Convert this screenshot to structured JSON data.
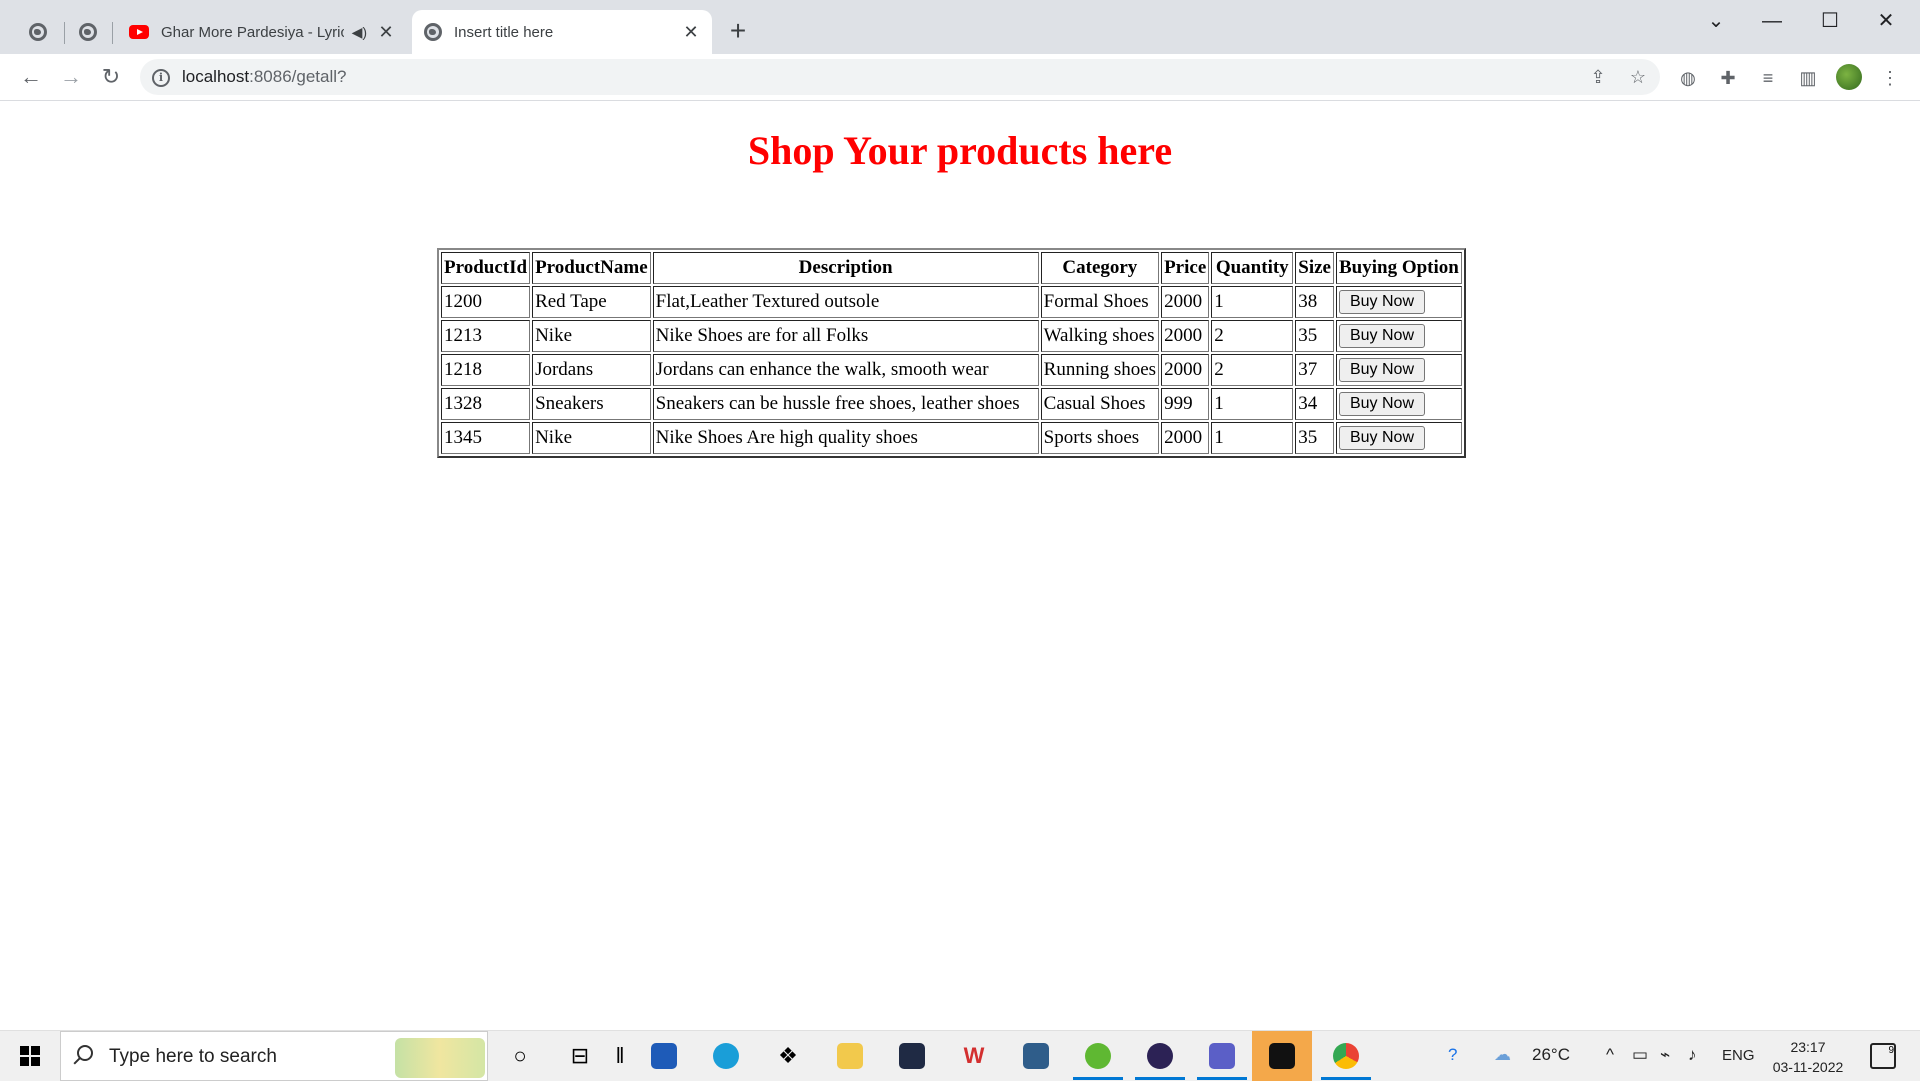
{
  "browser": {
    "tabs": [
      {
        "title": "Ghar More Pardesiya - Lyrica",
        "icon": "youtube-icon",
        "audio": true
      },
      {
        "title": "Insert title here",
        "icon": "globe-icon",
        "active": true
      }
    ],
    "new_tab_label": "+",
    "address": {
      "host": "localhost",
      "path": ":8086/getall?"
    },
    "window_controls": {
      "dropdown": "⌄",
      "minimize": "—",
      "maximize": "☐",
      "close": "✕"
    }
  },
  "page": {
    "heading": "Shop Your products here",
    "table": {
      "headers": [
        "ProductId",
        "ProductName",
        "Description",
        "Category",
        "Price",
        "Quantity",
        "Size",
        "Buying Option"
      ],
      "rows": [
        {
          "id": "1200",
          "name": "Red Tape",
          "description": "Flat,Leather Textured outsole",
          "category": "Formal Shoes",
          "price": "2000",
          "quantity": "1",
          "size": "38",
          "button": "Buy Now"
        },
        {
          "id": "1213",
          "name": "Nike",
          "description": "Nike Shoes are for all Folks",
          "category": "Walking shoes",
          "price": "2000",
          "quantity": "2",
          "size": "35",
          "button": "Buy Now"
        },
        {
          "id": "1218",
          "name": "Jordans",
          "description": "Jordans can enhance the walk, smooth wear",
          "category": "Running shoes",
          "price": "2000",
          "quantity": "2",
          "size": "37",
          "button": "Buy Now"
        },
        {
          "id": "1328",
          "name": "Sneakers",
          "description": "Sneakers can be hussle free shoes, leather shoes",
          "category": "Casual Shoes",
          "price": "999",
          "quantity": "1",
          "size": "34",
          "button": "Buy Now"
        },
        {
          "id": "1345",
          "name": "Nike",
          "description": "Nike Shoes Are high quality shoes",
          "category": "Sports shoes",
          "price": "2000",
          "quantity": "1",
          "size": "35",
          "button": "Buy Now"
        }
      ]
    }
  },
  "taskbar": {
    "search_placeholder": "Type here to search",
    "weather": "26°C",
    "language": "ENG",
    "time": "23:17",
    "date": "03-11-2022",
    "notification_count": "9"
  },
  "colors": {
    "heading": "#ff0000",
    "accent": "#0078d4"
  }
}
